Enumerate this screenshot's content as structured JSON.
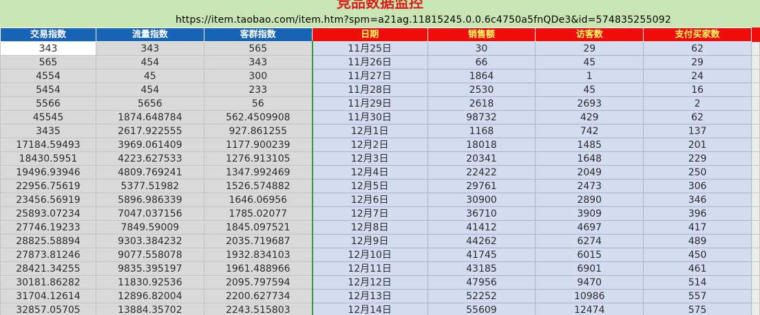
{
  "banner": {
    "title": "竞品数据监控",
    "url": "https://item.taobao.com/item.htm?spm=a21ag.11815245.0.0.6c4750a5fnQDe3&id=574835255092"
  },
  "headers": {
    "left": [
      "交易指数",
      "流量指数",
      "客群指数"
    ],
    "right": [
      "日期",
      "销售额",
      "访客数",
      "支付买家数"
    ]
  },
  "rows": [
    {
      "left": [
        "343",
        "343",
        "565"
      ],
      "right": [
        "11月25日",
        "30",
        "29",
        "62"
      ]
    },
    {
      "left": [
        "565",
        "454",
        "343"
      ],
      "right": [
        "11月26日",
        "66",
        "45",
        "29"
      ]
    },
    {
      "left": [
        "4554",
        "45",
        "300"
      ],
      "right": [
        "11月27日",
        "1864",
        "1",
        "24"
      ]
    },
    {
      "left": [
        "5454",
        "454",
        "233"
      ],
      "right": [
        "11月28日",
        "2530",
        "45",
        "16"
      ]
    },
    {
      "left": [
        "5566",
        "5656",
        "56"
      ],
      "right": [
        "11月29日",
        "2618",
        "2693",
        "2"
      ]
    },
    {
      "left": [
        "45545",
        "1874.648784",
        "562.4509908"
      ],
      "right": [
        "11月30日",
        "98732",
        "429",
        "62"
      ]
    },
    {
      "left": [
        "3435",
        "2617.922555",
        "927.861255"
      ],
      "right": [
        "12月1日",
        "1168",
        "742",
        "137"
      ]
    },
    {
      "left": [
        "17184.59493",
        "3969.061409",
        "1177.900239"
      ],
      "right": [
        "12月2日",
        "18018",
        "1485",
        "201"
      ]
    },
    {
      "left": [
        "18430.5951",
        "4223.627533",
        "1276.913105"
      ],
      "right": [
        "12月3日",
        "20341",
        "1648",
        "229"
      ]
    },
    {
      "left": [
        "19496.93946",
        "4809.769241",
        "1347.992469"
      ],
      "right": [
        "12月4日",
        "22422",
        "2049",
        "250"
      ]
    },
    {
      "left": [
        "22956.75619",
        "5377.51982",
        "1526.574882"
      ],
      "right": [
        "12月5日",
        "29761",
        "2473",
        "306"
      ]
    },
    {
      "left": [
        "23456.56919",
        "5896.986339",
        "1646.06956"
      ],
      "right": [
        "12月6日",
        "30900",
        "2890",
        "346"
      ]
    },
    {
      "left": [
        "25893.07234",
        "7047.037156",
        "1785.02077"
      ],
      "right": [
        "12月7日",
        "36710",
        "3909",
        "396"
      ]
    },
    {
      "left": [
        "27746.19233",
        "7849.59009",
        "1845.097521"
      ],
      "right": [
        "12月8日",
        "41412",
        "4697",
        "417"
      ]
    },
    {
      "left": [
        "28825.58894",
        "9303.384232",
        "2035.719687"
      ],
      "right": [
        "12月9日",
        "44262",
        "6274",
        "489"
      ]
    },
    {
      "left": [
        "27873.81246",
        "9077.558078",
        "1932.834103"
      ],
      "right": [
        "12月10日",
        "41745",
        "6015",
        "450"
      ]
    },
    {
      "left": [
        "28421.34255",
        "9835.395197",
        "1961.488966"
      ],
      "right": [
        "12月11日",
        "43185",
        "6901",
        "461"
      ]
    },
    {
      "left": [
        "30181.86282",
        "11830.92536",
        "2095.797594"
      ],
      "right": [
        "12月12日",
        "47956",
        "9470",
        "514"
      ]
    },
    {
      "left": [
        "31704.12614",
        "12896.82004",
        "2200.627734"
      ],
      "right": [
        "12月13日",
        "52252",
        "10986",
        "557"
      ]
    },
    {
      "left": [
        "32857.05705",
        "13884.35702",
        "2243.515803"
      ],
      "right": [
        "12月14日",
        "55609",
        "12474",
        "575"
      ]
    }
  ]
}
